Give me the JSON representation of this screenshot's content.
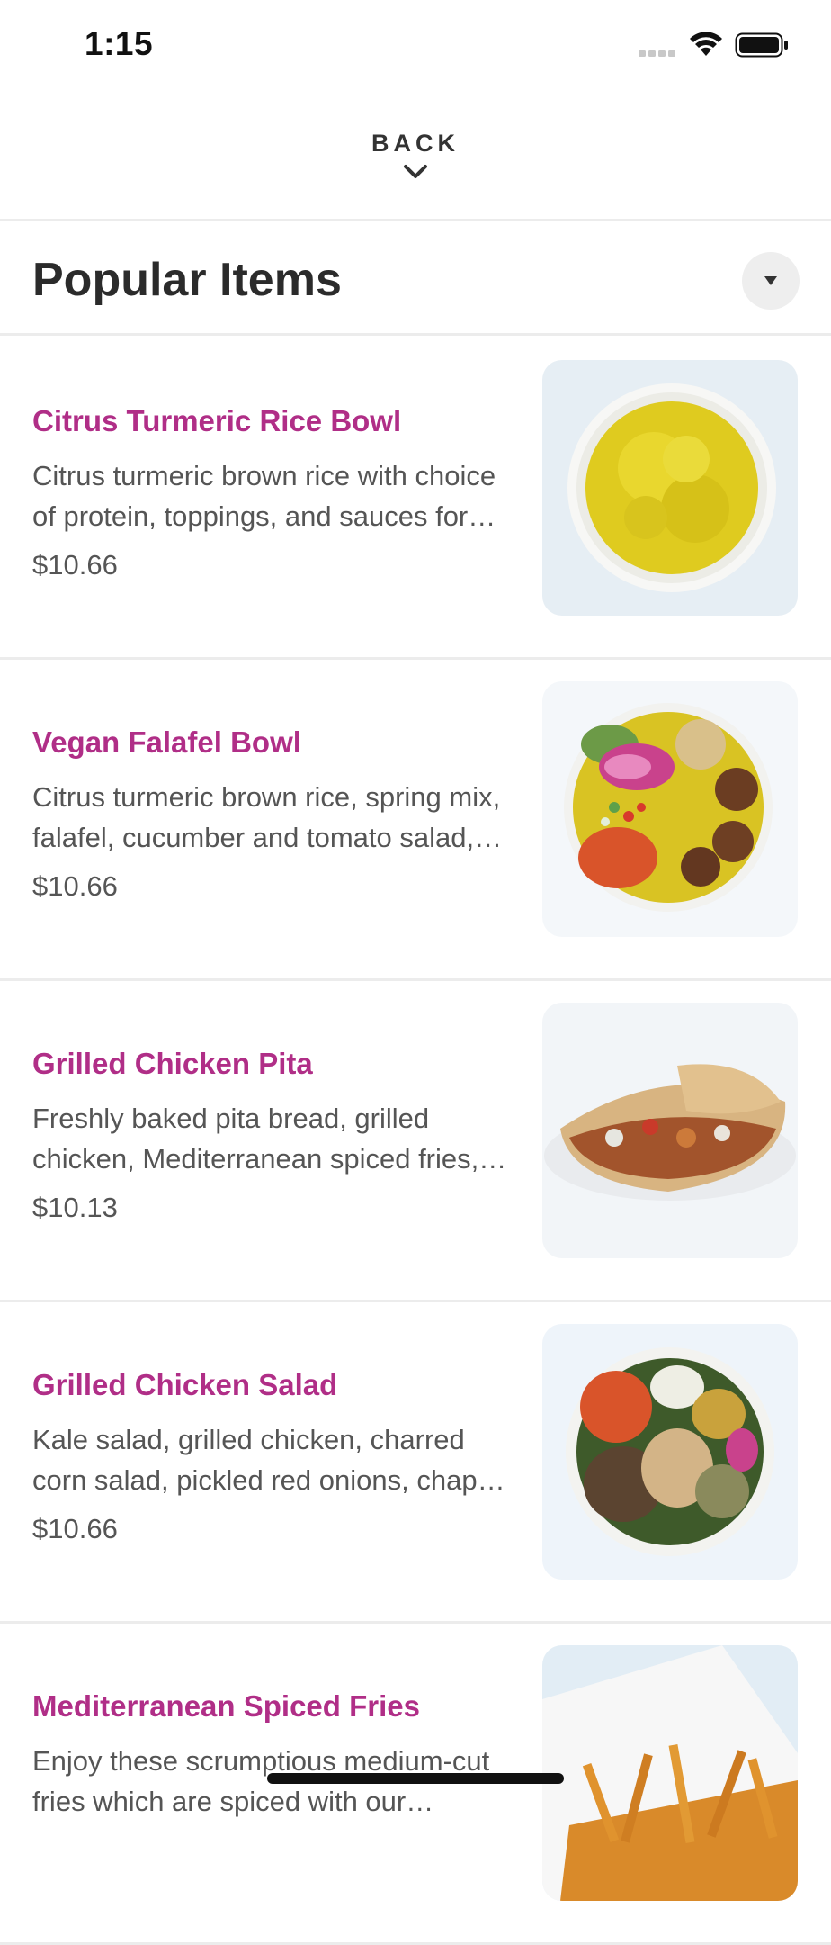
{
  "status_bar": {
    "time": "1:15"
  },
  "header": {
    "back_label": "BACK"
  },
  "section": {
    "title": "Popular Items"
  },
  "items": [
    {
      "name": "Citrus Turmeric Rice Bowl",
      "description": "Citrus turmeric brown rice with choice of protein, toppings, and sauces for you to build your own bowl",
      "price": "$10.66",
      "image": "rice-bowl"
    },
    {
      "name": "Vegan Falafel Bowl",
      "description": "Citrus turmeric brown rice, spring mix, falafel, cucumber and tomato salad, pickled red onions",
      "price": "$10.66",
      "image": "falafel-bowl"
    },
    {
      "name": "Grilled Chicken Pita",
      "description": "Freshly baked pita bread, grilled chicken, Mediterranean spiced fries, tomato, onions and sauces",
      "price": "$10.13",
      "image": "chicken-pita"
    },
    {
      "name": "Grilled Chicken Salad",
      "description": "Kale salad, grilled chicken, charred corn salad, pickled red onions, chapati crisps and feta",
      "price": "$10.66",
      "image": "chicken-salad"
    },
    {
      "name": "Mediterranean Spiced Fries",
      "description": "Enjoy these scrumptious medium-cut fries which are spiced with our signature blend",
      "price": "",
      "image": "spiced-fries"
    }
  ],
  "colors": {
    "accent": "#b02e87",
    "divider": "#ececec",
    "text_secondary": "#555555"
  }
}
